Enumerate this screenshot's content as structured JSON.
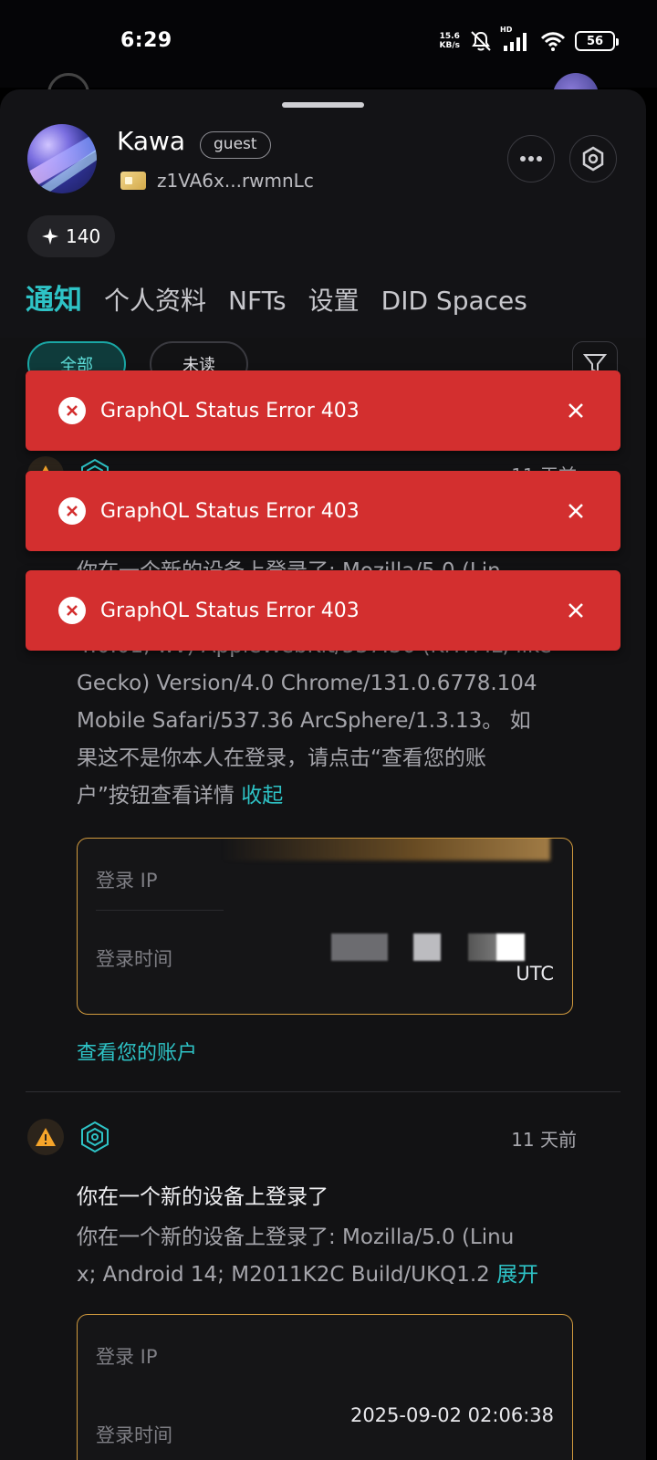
{
  "status_bar": {
    "time": "6:29",
    "net_speed_value": "15.6",
    "net_speed_unit": "KB/s",
    "signal_label": "HD",
    "battery": "56"
  },
  "profile": {
    "name": "Kawa",
    "role": "guest",
    "did": "z1VA6x...rwmnLc",
    "points": "140"
  },
  "tabs": [
    {
      "label": "通知",
      "active": true
    },
    {
      "label": "个人资料"
    },
    {
      "label": "NFTs"
    },
    {
      "label": "设置"
    },
    {
      "label": "DID Spaces"
    }
  ],
  "filters": {
    "all": "全部",
    "unread": "未读"
  },
  "toasts": [
    {
      "message": "GraphQL Status Error 403"
    },
    {
      "message": "GraphQL Status Error 403"
    },
    {
      "message": "GraphQL Status Error 403"
    }
  ],
  "notifications": [
    {
      "time": "11 天前",
      "body_line_partial": "你在一个新的设备上登录了: Mozilla/5.0 (Lin",
      "body_line_2": "4.0.01; wv) AppleWebKit/537.36 (KHTML, like",
      "body_line_3": "Gecko) Version/4.0 Chrome/131.0.6778.104",
      "body_line_4": "Mobile Safari/537.36 ArcSphere/1.3.13。 如",
      "body_line_5": "果这不是你本人在登录，请点击“查看您的账",
      "body_line_6": "户”按钮查看详情",
      "collapse_label": "收起",
      "card": {
        "ip_label": "登录 IP",
        "time_label": "登录时间",
        "time_suffix": "UTC"
      },
      "view_account": "查看您的账户"
    },
    {
      "time": "11 天前",
      "title": "你在一个新的设备上登录了",
      "body_line_1": "你在一个新的设备上登录了: Mozilla/5.0 (Linu",
      "body_line_2": "x; Android 14; M2011K2C Build/UKQ1.2",
      "expand_label": "展开",
      "card": {
        "ip_label": "登录 IP",
        "time_label": "登录时间",
        "time_value": "2025-09-02 02:06:38"
      }
    }
  ],
  "colors": {
    "accent": "#2ec3c6",
    "toast_bg": "#d32f2f",
    "warning": "#f6a52a",
    "card_border": "#d19a3e"
  }
}
